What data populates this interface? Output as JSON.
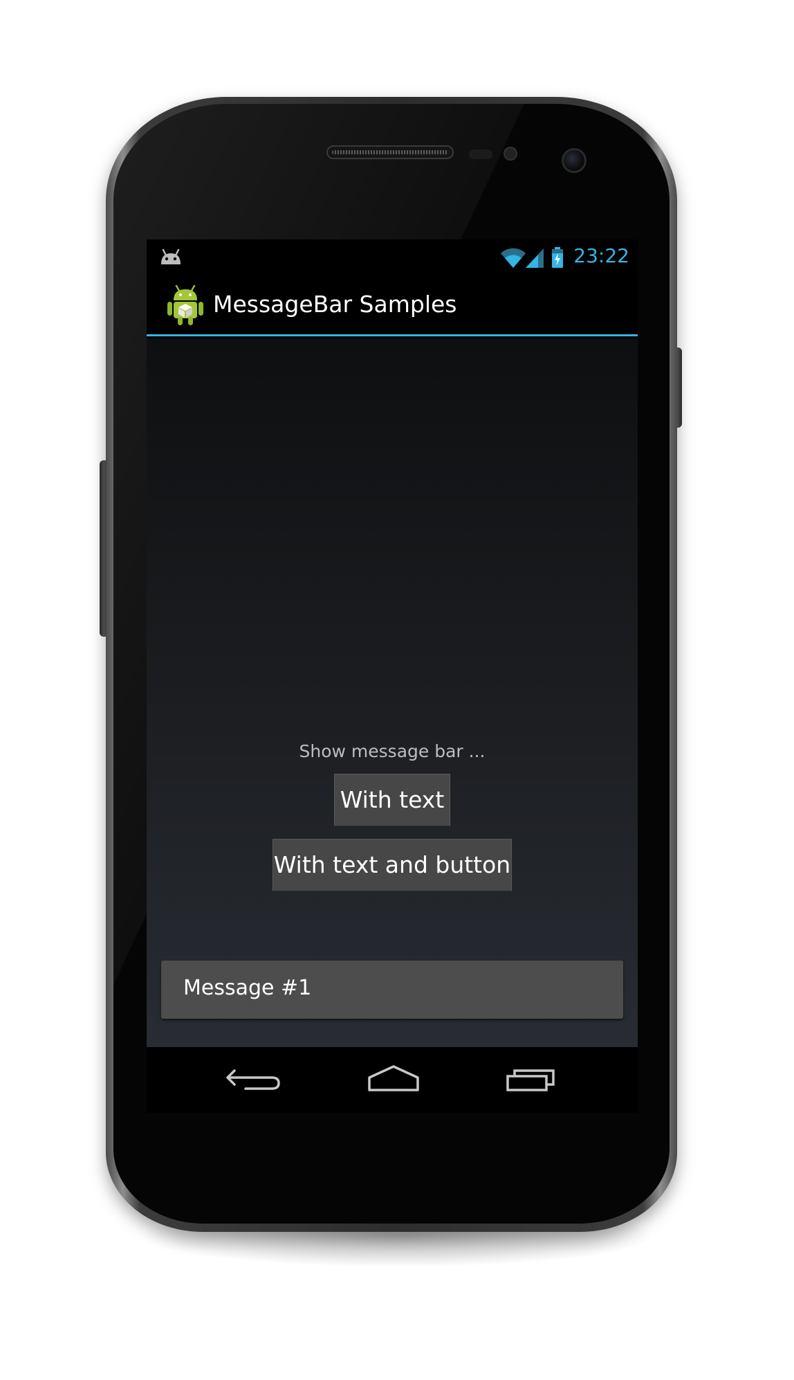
{
  "status_bar": {
    "time": "23:22",
    "notification_icon": "android-debug-icon",
    "wifi_icon": "wifi-icon",
    "signal_icon": "signal-icon",
    "battery_icon": "battery-charging-icon"
  },
  "action_bar": {
    "title": "MessageBar Samples",
    "app_icon": "android-app-icon"
  },
  "main": {
    "hint": "Show message bar ...",
    "button_with_text": "With text",
    "button_with_text_and_button": "With text and button"
  },
  "message_bar": {
    "text": "Message #1"
  },
  "nav_bar": {
    "back_icon": "back-icon",
    "home_icon": "home-icon",
    "recents_icon": "recent-apps-icon"
  },
  "colors": {
    "accent": "#33b5e5",
    "button_bg": "#474747",
    "message_bar_bg": "#4d4d4d"
  }
}
